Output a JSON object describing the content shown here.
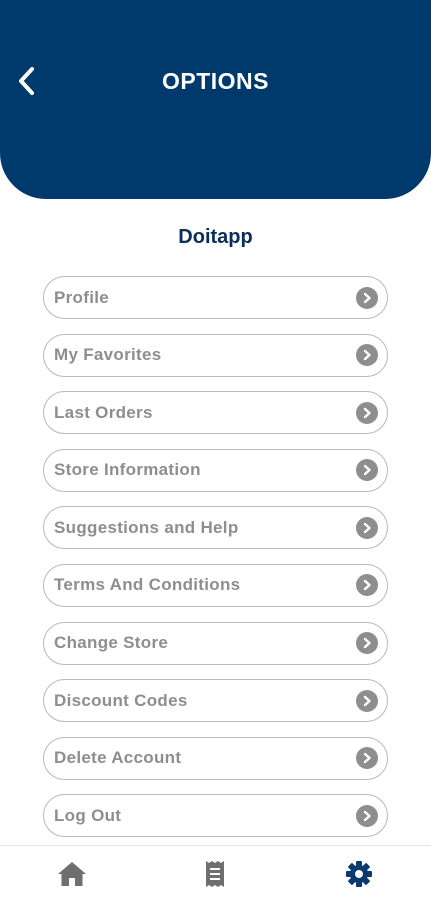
{
  "header": {
    "title": "OPTIONS",
    "background_color": "#003a6c",
    "back_icon": "chevron-left-icon"
  },
  "store": {
    "name": "Doitapp"
  },
  "menu": {
    "items": [
      {
        "label": "Profile"
      },
      {
        "label": "My Favorites"
      },
      {
        "label": "Last Orders"
      },
      {
        "label": "Store Information"
      },
      {
        "label": "Suggestions and Help"
      },
      {
        "label": "Terms And Conditions"
      },
      {
        "label": "Change Store"
      },
      {
        "label": "Discount Codes"
      },
      {
        "label": "Delete Account"
      },
      {
        "label": "Log Out"
      }
    ],
    "item_icon": "chevron-right-circle-icon"
  },
  "bottom_nav": {
    "items": [
      {
        "icon": "home-icon",
        "active": false
      },
      {
        "icon": "receipt-icon",
        "active": false
      },
      {
        "icon": "gear-icon",
        "active": true
      }
    ],
    "active_color": "#0b3a6e",
    "inactive_color": "#6f6f6f"
  }
}
